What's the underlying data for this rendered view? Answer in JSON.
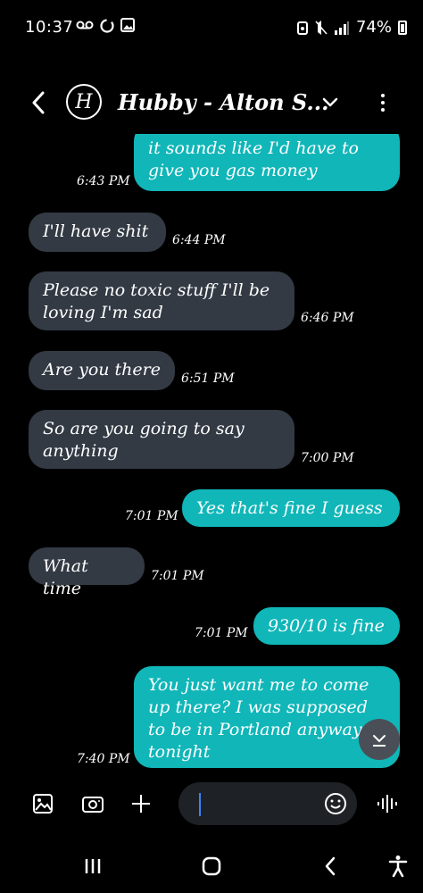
{
  "status_bar": {
    "time": "10:37",
    "left_icons": [
      "voicemail-icon",
      "sync-icon",
      "gallery-icon"
    ],
    "right_icons": [
      "alarm-icon",
      "mute-icon",
      "signal-icon"
    ],
    "battery": "74%"
  },
  "header": {
    "avatar_letter": "H",
    "contact_name": "Hubby - Alton S..."
  },
  "messages": [
    {
      "direction": "out",
      "lines": [
        "it sounds like I'd have to",
        "give you gas money"
      ],
      "time": "6:43 PM"
    },
    {
      "direction": "in",
      "lines": [
        "I'll have shit"
      ],
      "time": "6:44 PM"
    },
    {
      "direction": "in",
      "lines": [
        "Please no toxic stuff I'll be",
        "loving I'm sad"
      ],
      "time": "6:46 PM"
    },
    {
      "direction": "in",
      "lines": [
        "Are you there"
      ],
      "time": "6:51 PM"
    },
    {
      "direction": "in",
      "lines": [
        "So are you going to say",
        "anything"
      ],
      "time": "7:00 PM"
    },
    {
      "direction": "out",
      "lines": [
        "Yes that's fine I guess"
      ],
      "time": "7:01 PM"
    },
    {
      "direction": "in",
      "lines": [
        "What time"
      ],
      "time": "7:01 PM"
    },
    {
      "direction": "out",
      "lines": [
        "930/10 is fine"
      ],
      "time": "7:01 PM"
    },
    {
      "direction": "out",
      "lines": [
        "You just want me to come",
        "up there? I was supposed",
        "to be in Portland anyway",
        "tonight"
      ],
      "time": "7:40 PM"
    }
  ],
  "colors": {
    "incoming_bubble": "#333a44",
    "outgoing_bubble": "#10b6b8",
    "background": "#000000"
  },
  "composer": {
    "icons": [
      "gallery-icon",
      "camera-icon",
      "add-icon",
      "emoji-icon",
      "voice-icon"
    ],
    "placeholder": ""
  },
  "nav_bar": {
    "icons": [
      "recent-apps-icon",
      "home-icon",
      "back-icon",
      "accessibility-icon"
    ]
  }
}
